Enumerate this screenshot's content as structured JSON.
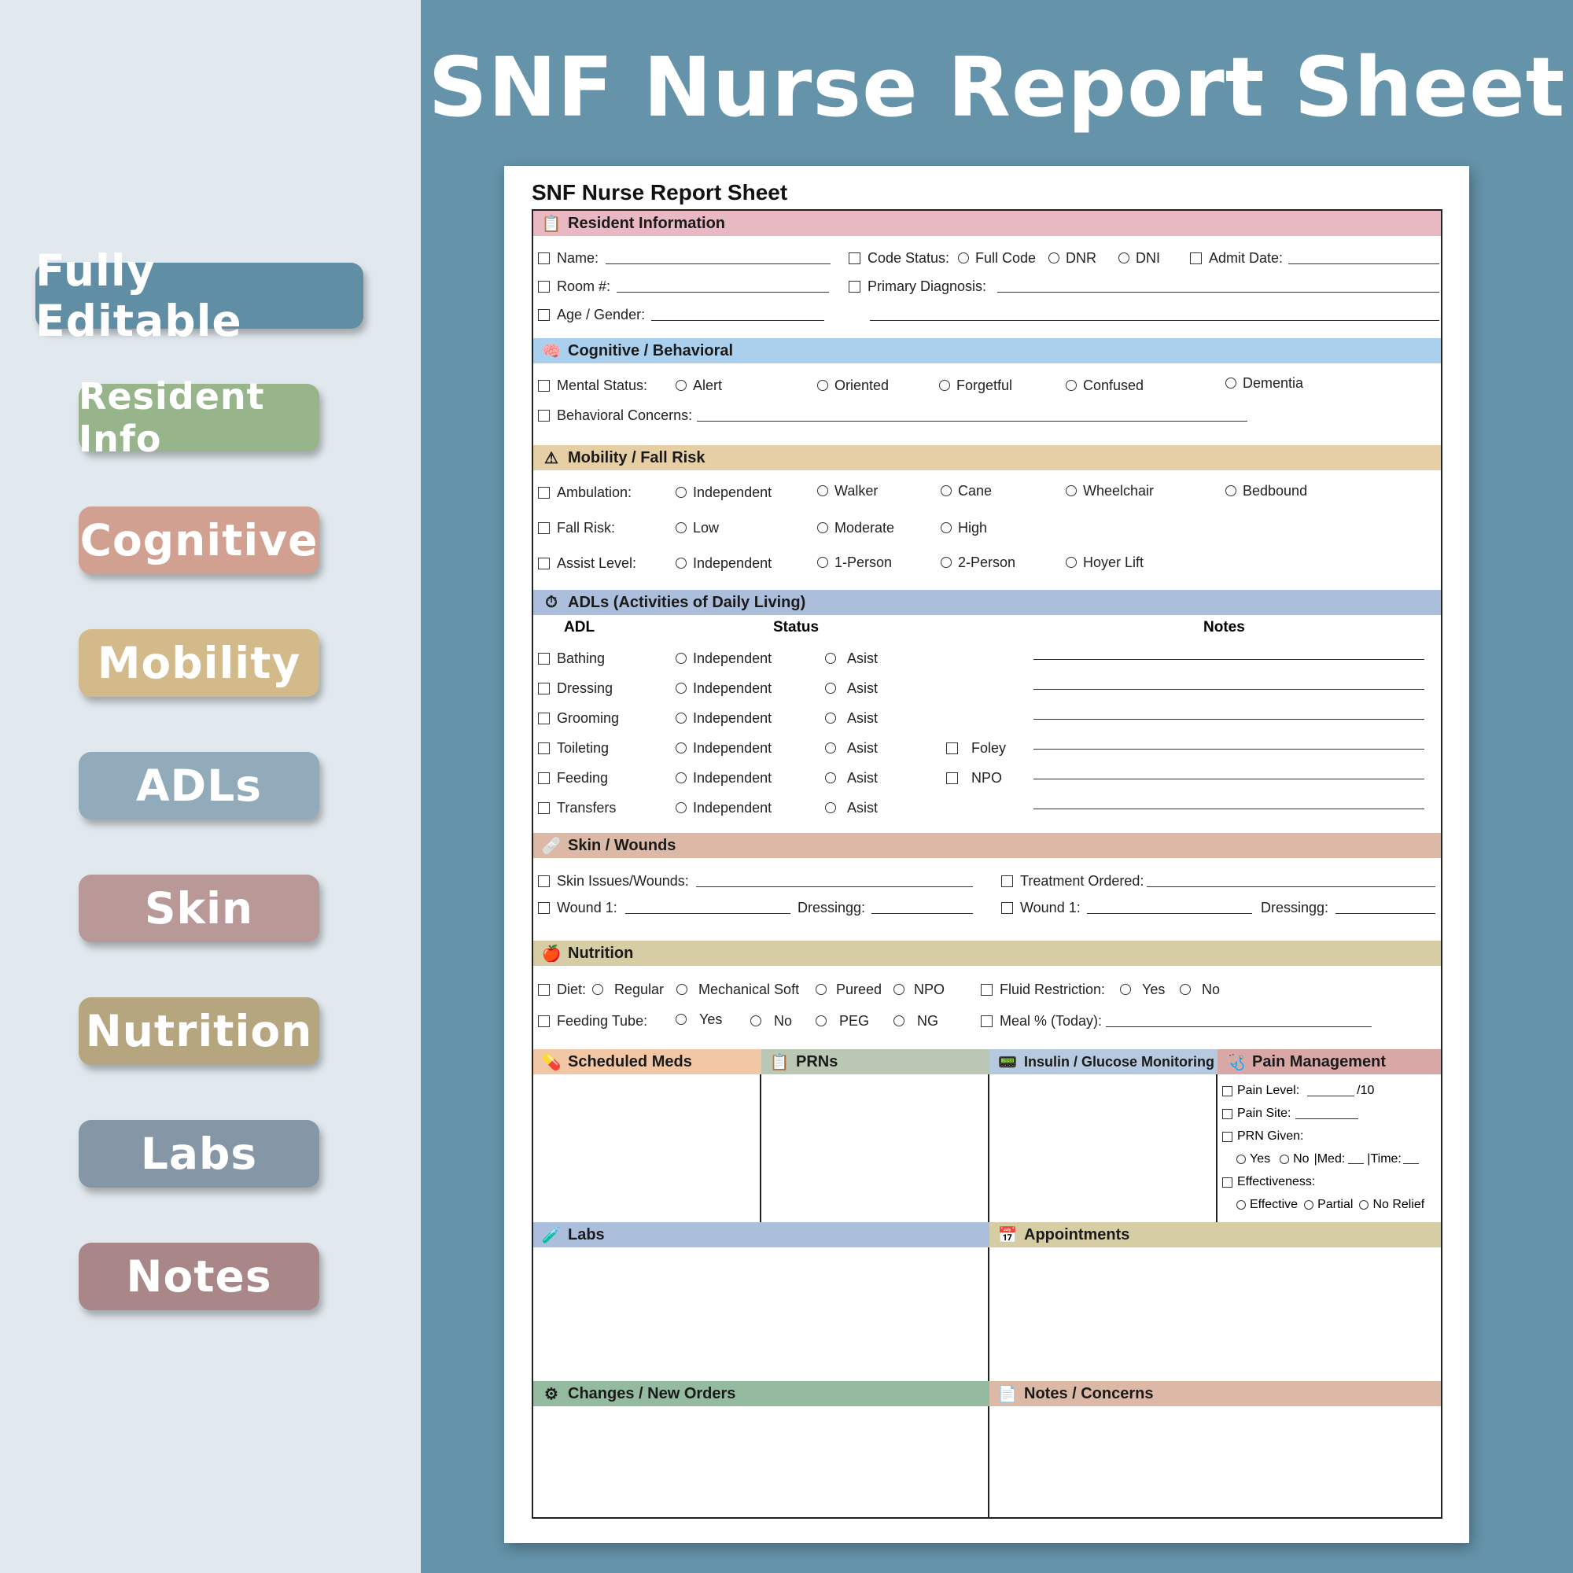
{
  "banner_title": "SNF Nurse Report Sheet",
  "tags": [
    {
      "label": "Fully Editable",
      "color": "#5f8ea5"
    },
    {
      "label": "Resident Info",
      "color": "#98b48a"
    },
    {
      "label": "Cognitive",
      "color": "#d1a090"
    },
    {
      "label": "Mobility",
      "color": "#d2ba8a"
    },
    {
      "label": "ADLs",
      "color": "#91abbb"
    },
    {
      "label": "Skin",
      "color": "#b99898"
    },
    {
      "label": "Nutrition",
      "color": "#b6a67f"
    },
    {
      "label": "Labs",
      "color": "#8597a6"
    },
    {
      "label": "Notes",
      "color": "#a98789"
    }
  ],
  "sheet": {
    "title": "SNF Nurse Report Sheet",
    "resident": {
      "header": "Resident Information",
      "color": "#e8b9c3",
      "name": "Name:",
      "room": "Room #:",
      "age_gender": "Age / Gender:",
      "code_status": "Code Status:",
      "code_options": [
        "Full Code",
        "DNR",
        "DNI"
      ],
      "admit_date": "Admit Date:",
      "primary_diagnosis": "Primary Diagnosis:"
    },
    "cognitive": {
      "header": "Cognitive / Behavioral",
      "color": "#aad0ee",
      "mental_status": "Mental Status:",
      "options": [
        "Alert",
        "Oriented",
        "Forgetful",
        "Confused",
        "Dementia"
      ],
      "behavioral": "Behavioral Concerns:"
    },
    "mobility": {
      "header": "Mobility / Fall Risk",
      "color": "#e6cfa4",
      "ambulation": "Ambulation:",
      "ambulation_options": [
        "Independent",
        "Walker",
        "Cane",
        "Wheelchair",
        "Bedbound"
      ],
      "fall_risk": "Fall Risk:",
      "fall_options": [
        "Low",
        "Moderate",
        "High"
      ],
      "assist": "Assist Level:",
      "assist_options": [
        "Independent",
        "1-Person",
        "2-Person",
        "Hoyer Lift"
      ]
    },
    "adls": {
      "header": "ADLs (Activities of Daily Living)",
      "color": "#abbedb",
      "col_adl": "ADL",
      "col_status": "Status",
      "col_notes": "Notes",
      "rows": [
        {
          "name": "Bathing",
          "opt1": "Independent",
          "opt2": "Asist",
          "extra": ""
        },
        {
          "name": "Dressing",
          "opt1": "Independent",
          "opt2": "Asist",
          "extra": ""
        },
        {
          "name": "Grooming",
          "opt1": "Independent",
          "opt2": "Asist",
          "extra": ""
        },
        {
          "name": "Toileting",
          "opt1": "Independent",
          "opt2": "Asist",
          "extra": "Foley"
        },
        {
          "name": "Feeding",
          "opt1": "Independent",
          "opt2": "Asist",
          "extra": "NPO"
        },
        {
          "name": "Transfers",
          "opt1": "Independent",
          "opt2": "Asist",
          "extra": ""
        }
      ]
    },
    "skin": {
      "header": "Skin / Wounds",
      "color": "#dcb8a6",
      "issues": "Skin Issues/Wounds:",
      "treatment": "Treatment Ordered:",
      "wound": "Wound 1:",
      "dressing": "Dressingg:"
    },
    "nutrition": {
      "header": "Nutrition",
      "color": "#d6cda4",
      "diet": "Diet:",
      "diet_options": [
        "Regular",
        "Mechanical Soft",
        "Pureed",
        "NPO"
      ],
      "fluid": "Fluid Restriction:",
      "fluid_options": [
        "Yes",
        "No"
      ],
      "tube": "Feeding Tube:",
      "tube_options": [
        "Yes",
        "No",
        "PEG",
        "NG"
      ],
      "meal": "Meal % (Today):"
    },
    "boxes": {
      "sched_meds": {
        "label": "Scheduled Meds",
        "color": "#f2c7a6"
      },
      "prns": {
        "label": "PRNs",
        "color": "#b9c7b4"
      },
      "insulin": {
        "label": "Insulin / Glucose Monitoring",
        "color": "#b6c9de"
      },
      "pain": {
        "label": "Pain Management",
        "color": "#d7a8a6"
      },
      "labs": {
        "label": "Labs",
        "color": "#abbedb"
      },
      "appointments": {
        "label": "Appointments",
        "color": "#d6cda4"
      },
      "changes": {
        "label": "Changes / New Orders",
        "color": "#94bba0"
      },
      "notes": {
        "label": "Notes / Concerns",
        "color": "#dcb8a6"
      }
    },
    "pain": {
      "level": "Pain Level:",
      "level_suffix": "/10",
      "site": "Pain Site:",
      "prn_given": "PRN Given:",
      "yes": "Yes",
      "no": "No",
      "med": "|Med:",
      "time": "|Time:",
      "effectiveness": "Effectiveness:",
      "eff_options": [
        "Effective",
        "Partial",
        "No Relief"
      ]
    }
  }
}
